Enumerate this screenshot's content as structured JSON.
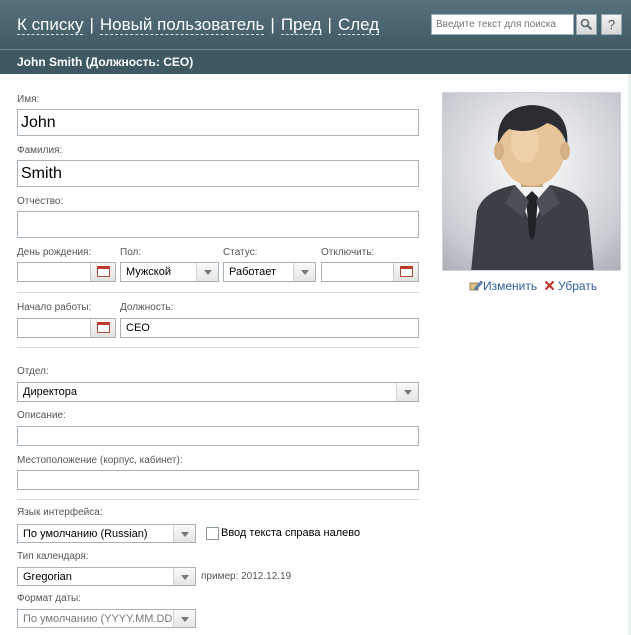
{
  "header": {
    "nav_back": "К списку",
    "nav_new": "Новый пользователь",
    "nav_prev": "Пред",
    "nav_next": "След",
    "separator": "|",
    "search_placeholder": "Введите текст для поиска",
    "help_label": "?"
  },
  "title": "John Smith (Должность: CEO)",
  "form": {
    "first_name_label": "Имя:",
    "first_name_value": "John",
    "last_name_label": "Фамилия:",
    "last_name_value": "Smith",
    "middle_name_label": "Отчество:",
    "middle_name_value": "",
    "birthday_label": "День рождения:",
    "gender_label": "Пол:",
    "gender_value": "Мужской",
    "status_label": "Статус:",
    "status_value": "Работает",
    "disable_label": "Отключить:",
    "start_label": "Начало работы:",
    "position_label": "Должность:",
    "position_value": "CEO",
    "department_label": "Отдел:",
    "department_value": "Директора",
    "description_label": "Описание:",
    "location_label": "Местоположение (корпус, кабинет):",
    "language_label": "Язык интерфейса:",
    "language_value": "По умолчанию (Russian)",
    "rtl_label": "Ввод текста справа налево",
    "calendar_label": "Тип календаря:",
    "calendar_value": "Gregorian",
    "calendar_example": "пример: 2012.12.19",
    "date_format_label": "Формат даты:",
    "date_format_value": "По умолчанию (YYYY.MM.DD)"
  },
  "photo": {
    "edit_label": "Изменить",
    "remove_label": "Убрать"
  },
  "colors": {
    "header_bg": "#4a6570",
    "subheader_bg": "#3f5963",
    "link": "#2b5f9e",
    "remove_icon": "#c0392b"
  }
}
